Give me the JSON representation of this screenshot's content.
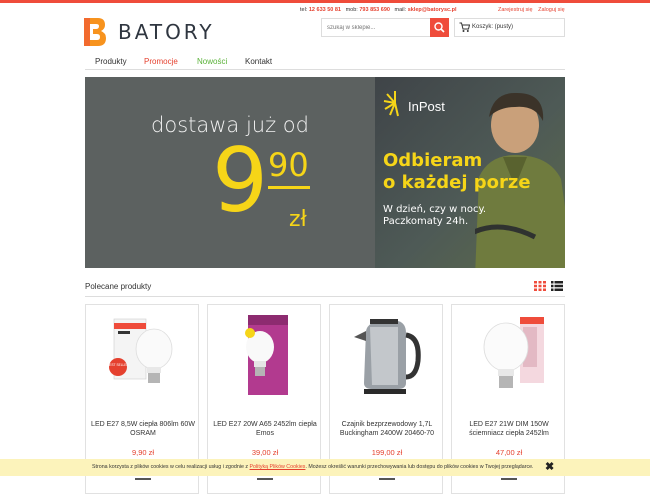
{
  "header": {
    "phone_label": "tel:",
    "phone": "12 633 50 81",
    "mobile_label": "mob:",
    "mobile": "793 853 690",
    "mail_label": "mail:",
    "mail": "sklep@batorysc.pl",
    "register": "Zarejestruj się",
    "login": "Zaloguj się",
    "logo_text": "BATORY",
    "search_placeholder": "szukaj w sklepie...",
    "cart_label": "Koszyk: (pusty)"
  },
  "colors": {
    "accent": "#ef4c3b",
    "promo": "#e5412f",
    "new": "#5ab239",
    "yellow": "#f6d518"
  },
  "nav": {
    "items": [
      {
        "label": "Produkty",
        "color": "#333333"
      },
      {
        "label": "Promocje",
        "color": "#e5412f"
      },
      {
        "label": "Nowości",
        "color": "#5ab239"
      },
      {
        "label": "Kontakt",
        "color": "#333333"
      }
    ]
  },
  "banner": {
    "title": "dostawa już od",
    "price_main": "9",
    "price_cents": "90",
    "currency": "zł",
    "brand": "InPost",
    "headline": "Odbieram\no każdej porze",
    "sub": "W dzień, czy w nocy.\nPaczkomaty 24h."
  },
  "section": {
    "title": "Polecane produkty"
  },
  "products": [
    {
      "name": "LED E27 8,5W ciepła 806lm 60W OSRAM",
      "price": "9,90 zł",
      "badge": "BEST SELLER",
      "image": "osram-led-bulb"
    },
    {
      "name": "LED E27 20W A65 2452lm ciepła Emos",
      "price": "39,00 zł",
      "image": "emos-led-bulb-purple-box"
    },
    {
      "name": "Czajnik bezprzewodowy 1,7L Buckingham 2400W 20460-70",
      "price": "199,00 zł",
      "image": "steel-kettle"
    },
    {
      "name": "LED E27 21W DIM 150W ściemniacz ciepła 2452lm",
      "price": "47,00 zł",
      "image": "osram-dim-led-bulb"
    }
  ],
  "cookie": {
    "text_before": "Strona korzysta z plików cookies w celu realizacji usług i zgodnie z ",
    "link": "Polityką Plików Cookies",
    "text_after": ". Możesz określić warunki przechowywania lub dostępu do plików cookies w Twojej przeglądarce.",
    "close": "✖"
  }
}
